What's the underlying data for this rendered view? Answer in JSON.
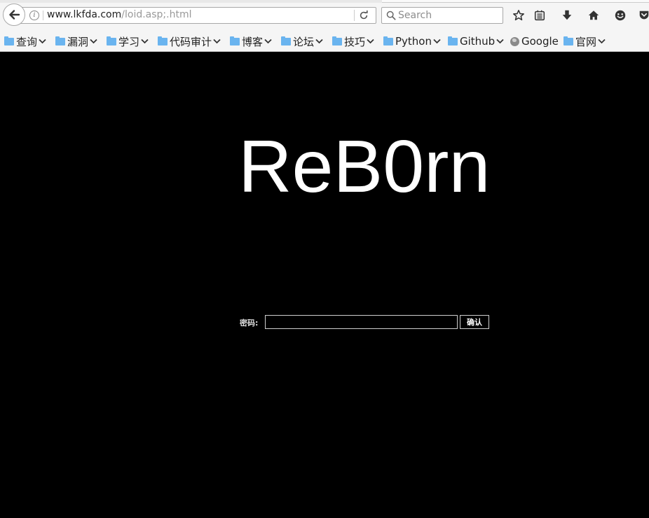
{
  "browser": {
    "url_domain": "www.lkfda.com",
    "url_path": "/loid.asp;.html",
    "search_placeholder": "Search"
  },
  "bookmarks": [
    {
      "label": "查询",
      "type": "folder"
    },
    {
      "label": "漏洞",
      "type": "folder"
    },
    {
      "label": "学习",
      "type": "folder"
    },
    {
      "label": "代码审计",
      "type": "folder"
    },
    {
      "label": "博客",
      "type": "folder"
    },
    {
      "label": "论坛",
      "type": "folder"
    },
    {
      "label": "技巧",
      "type": "folder"
    },
    {
      "label": "Python",
      "type": "folder"
    },
    {
      "label": "Github",
      "type": "folder"
    },
    {
      "label": "Google",
      "type": "link"
    },
    {
      "label": "官网",
      "type": "folder"
    }
  ],
  "page": {
    "logo_text": "ReB0rn",
    "password_label": "密码:",
    "password_value": "",
    "submit_label": "确认"
  },
  "colors": {
    "page_background": "#000000",
    "logo_text": "#ffffff",
    "toolbar_background": "#f5f5f5",
    "folder_icon": "#6ab4ef"
  },
  "icons": [
    "back-arrow-icon",
    "info-icon",
    "reload-icon",
    "search-icon",
    "star-icon",
    "reading-list-icon",
    "download-icon",
    "home-icon",
    "emoji-icon",
    "pocket-icon",
    "folder-icon",
    "globe-icon",
    "chevron-down-icon"
  ]
}
